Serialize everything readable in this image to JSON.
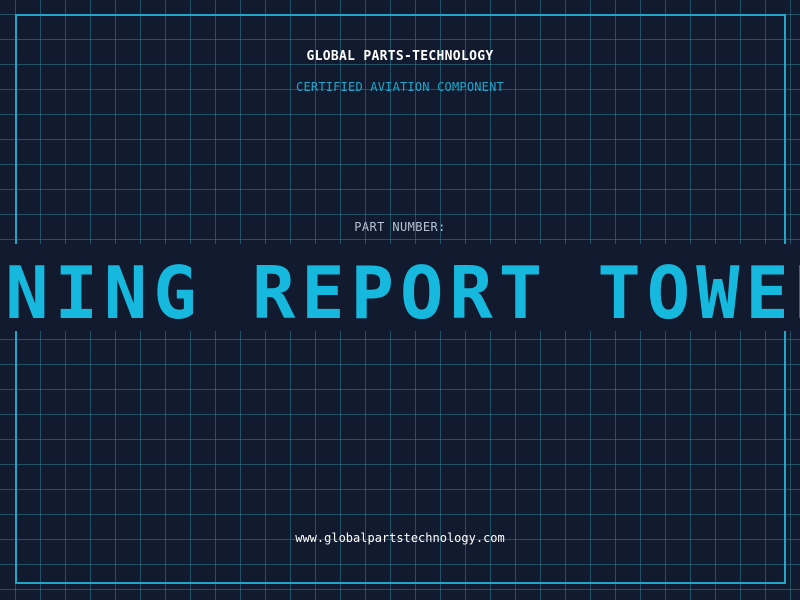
{
  "header": {
    "company": "GLOBAL PARTS-TECHNOLOGY",
    "subtitle": "CERTIFIED AVIATION COMPONENT"
  },
  "part": {
    "label": "PART NUMBER:",
    "value": "RNING REPORT TOWER"
  },
  "footer": {
    "website": "www.globalpartstechnology.com"
  },
  "colors": {
    "background": "#111a2e",
    "accent": "#1fa6c9",
    "part_number": "#16b8dd",
    "text": "#ffffff",
    "muted": "#b4c2d4"
  }
}
